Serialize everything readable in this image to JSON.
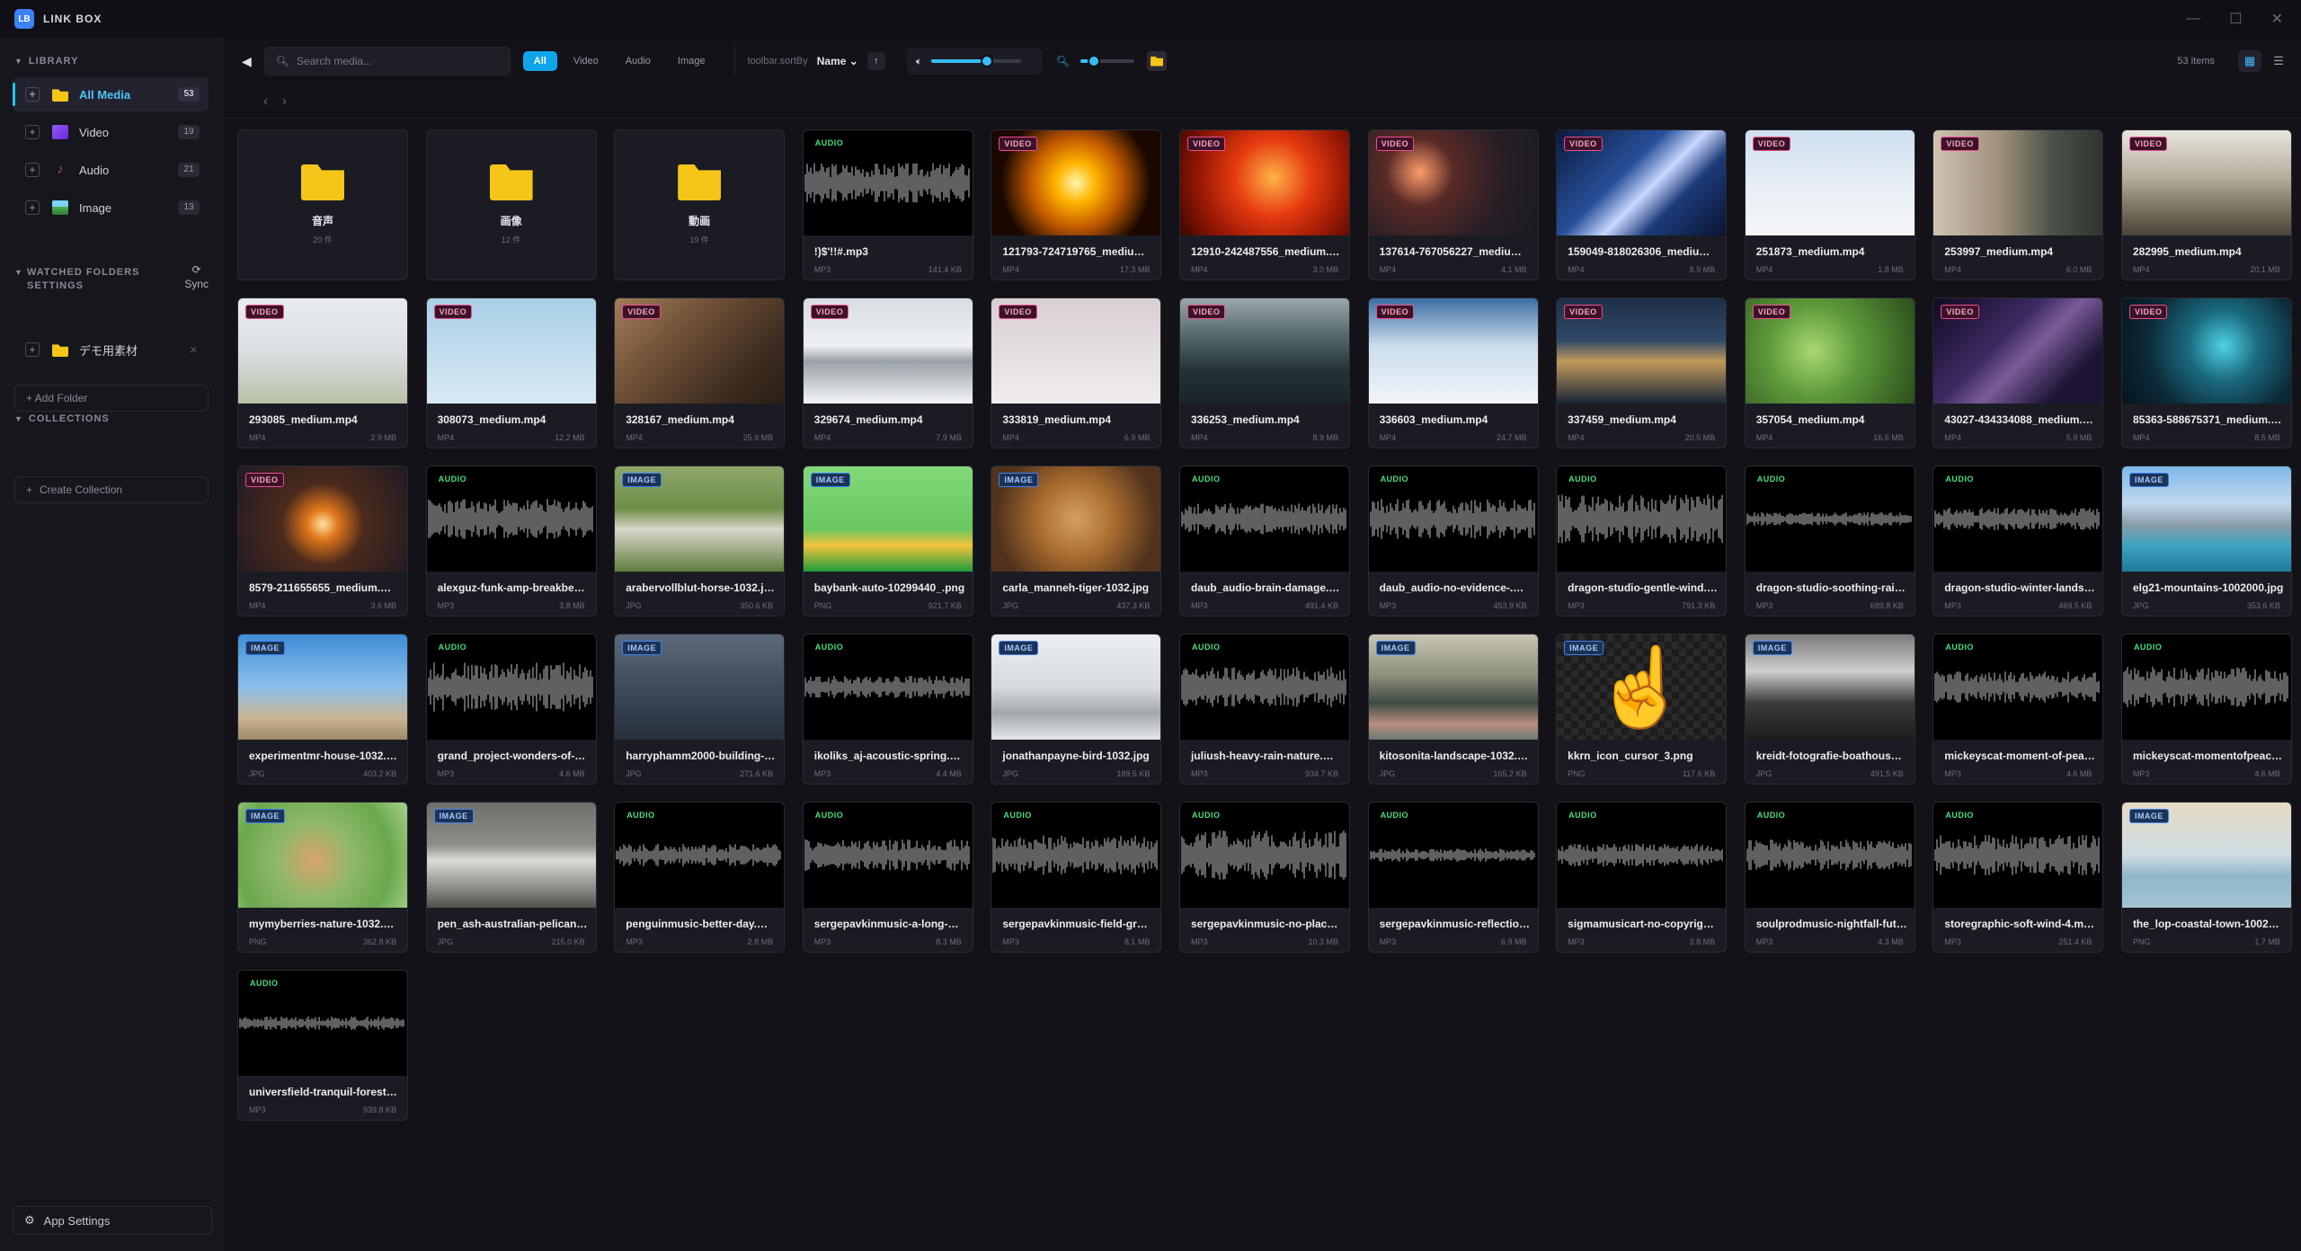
{
  "app": {
    "title": "LINK BOX",
    "logo_text": "LB"
  },
  "window_controls": [
    "—",
    "☐",
    "✕"
  ],
  "sidebar": {
    "library_heading": "LIBRARY",
    "items": [
      {
        "label": "All Media",
        "count": "53",
        "icon_color": "#f5c518",
        "active": true
      },
      {
        "label": "Video",
        "count": "19",
        "icon_color": "#8b5cf6",
        "active": false
      },
      {
        "label": "Audio",
        "count": "21",
        "icon_color": "#b9447a",
        "active": false
      },
      {
        "label": "Image",
        "count": "13",
        "icon_color": "#4caf50",
        "active": false
      }
    ],
    "watched_heading_1": "WATCHED FOLDERS",
    "watched_heading_2": "SETTINGS",
    "sync_label": "Sync",
    "watched_folder": "デモ用素材",
    "add_folder_label": "+ Add Folder",
    "collections_heading": "COLLECTIONS",
    "create_collection_label": "Create Collection",
    "app_settings_label": "App Settings"
  },
  "toolbar": {
    "search_placeholder": "Search media...",
    "filters": [
      "All",
      "Video",
      "Audio",
      "Image"
    ],
    "active_filter": "All",
    "sort_label": "toolbar.sortBy",
    "sort_value": "Name ⌄",
    "item_count": "53 items",
    "volume_level": 0.62,
    "zoom_level": 0.25
  },
  "colors": {
    "accent": "#0ea5e9",
    "video_badge": "#ee4d8f",
    "audio_badge": "#4ade80",
    "image_badge": "#3b82f6",
    "folder": "#f5c518"
  },
  "items": [
    {
      "kind": "folder",
      "name": "音声",
      "meta": "20 件"
    },
    {
      "kind": "folder",
      "name": "画像",
      "meta": "12 件"
    },
    {
      "kind": "folder",
      "name": "動画",
      "meta": "19 件"
    },
    {
      "kind": "audio",
      "badge": "AUDIO",
      "name": "!)$'!!#.mp3",
      "type": "MP3",
      "size": "141.4 KB"
    },
    {
      "kind": "video",
      "badge": "VIDEO",
      "name": "121793-724719765_medium.mp4",
      "type": "MP4",
      "size": "17.3 MB",
      "bg": "radial-gradient(circle at 50% 50%, #fff6b0 0%, #ffb400 20%, #c35a00 45%, #1a0800 75%)"
    },
    {
      "kind": "video",
      "badge": "VIDEO",
      "name": "12910-242487556_medium.mp4",
      "type": "MP4",
      "size": "3.0 MB",
      "bg": "radial-gradient(circle at 55% 45%, #ffb347 0%, #e63b10 35%, #9e1a05 65%, #3a0600 100%)"
    },
    {
      "kind": "video",
      "badge": "VIDEO",
      "name": "137614-767056227_medium.mp4",
      "type": "MP4",
      "size": "4.1 MB",
      "bg": "radial-gradient(circle at 30% 40%, #ff9c6b 0%, #5a2a26 25%, #2a1f26 60%, #1a1a22 100%)"
    },
    {
      "kind": "video",
      "badge": "VIDEO",
      "name": "159049-818026306_medium.mp4",
      "type": "MP4",
      "size": "8.9 MB",
      "bg": "linear-gradient(135deg, #0b1a3d 0%, #27509a 40%, #c9d7ff 55%, #1d3b7a 70%, #0a1430 100%)"
    },
    {
      "kind": "video",
      "badge": "VIDEO",
      "name": "251873_medium.mp4",
      "type": "MP4",
      "size": "1.8 MB",
      "bg": "linear-gradient(180deg, #cfe0f0 0%, #e8eef5 55%, #f5f7fa 100%)"
    },
    {
      "kind": "video",
      "badge": "VIDEO",
      "name": "253997_medium.mp4",
      "type": "MP4",
      "size": "6.0 MB",
      "bg": "linear-gradient(90deg, #cfc3b3 0%, #9e8f7b 40%, #4b5248 70%, #2d3530 100%)"
    },
    {
      "kind": "video",
      "badge": "VIDEO",
      "name": "282995_medium.mp4",
      "type": "MP4",
      "size": "20.1 MB",
      "bg": "linear-gradient(180deg, #e9e6df 0%, #b6ad9c 45%, #6f6657 80%, #4b4438 100%)"
    },
    {
      "kind": "video",
      "badge": "VIDEO",
      "name": "293085_medium.mp4",
      "type": "MP4",
      "size": "2.9 MB",
      "bg": "linear-gradient(180deg, #e9ecef 0%, #dadfe3 50%, #b7c1a8 100%)"
    },
    {
      "kind": "video",
      "badge": "VIDEO",
      "name": "308073_medium.mp4",
      "type": "MP4",
      "size": "12.2 MB",
      "bg": "linear-gradient(180deg, #a9cfe6 0%, #c6e0ef 60%, #d8eaf4 100%)"
    },
    {
      "kind": "video",
      "badge": "VIDEO",
      "name": "328167_medium.mp4",
      "type": "MP4",
      "size": "25.9 MB",
      "bg": "linear-gradient(135deg, #a27c5a 0%, #6b4d34 40%, #3d2c1f 75%, #2a1e15 100%)"
    },
    {
      "kind": "video",
      "badge": "VIDEO",
      "name": "329674_medium.mp4",
      "type": "MP4",
      "size": "7.9 MB",
      "bg": "linear-gradient(180deg, #d7dde3 0%, #eef1f4 45%, #9aa1a8 60%, #f4f6f8 100%)"
    },
    {
      "kind": "video",
      "badge": "VIDEO",
      "name": "333819_medium.mp4",
      "type": "MP4",
      "size": "6.9 MB",
      "bg": "linear-gradient(180deg, #d8cfd3 0%, #e6dfe2 55%, #f0ecee 100%)"
    },
    {
      "kind": "video",
      "badge": "VIDEO",
      "name": "336253_medium.mp4",
      "type": "MP4",
      "size": "8.9 MB",
      "bg": "linear-gradient(180deg, #9aa7ab 0%, #4d6066 40%, #233136 70%, #1a2428 100%)"
    },
    {
      "kind": "video",
      "badge": "VIDEO",
      "name": "336603_medium.mp4",
      "type": "MP4",
      "size": "24.7 MB",
      "bg": "linear-gradient(180deg, #3d6ea3 0%, #cbdcec 45%, #f2f6fa 100%)"
    },
    {
      "kind": "video",
      "badge": "VIDEO",
      "name": "337459_medium.mp4",
      "type": "MP4",
      "size": "20.5 MB",
      "bg": "linear-gradient(180deg, #1e2f48 0%, #2f4967 40%, #c19a5b 60%, #182536 100%)"
    },
    {
      "kind": "video",
      "badge": "VIDEO",
      "name": "357054_medium.mp4",
      "type": "MP4",
      "size": "16.6 MB",
      "bg": "radial-gradient(circle at 40% 50%, #a9d873 0%, #5d9a3a 40%, #2b4d1c 100%)"
    },
    {
      "kind": "video",
      "badge": "VIDEO",
      "name": "43027-434334088_medium.mp4",
      "type": "MP4",
      "size": "5.9 MB",
      "bg": "linear-gradient(135deg, #120a22 0%, #3d2a63 40%, #7a5b9a 55%, #1d1433 80%)"
    },
    {
      "kind": "video",
      "badge": "VIDEO",
      "name": "85363-588675371_medium.mp4",
      "type": "MP4",
      "size": "8.5 MB",
      "bg": "radial-gradient(circle at 60% 45%, #4fd2e6 0%, #1b6a7f 30%, #0c2a38 65%, #06141c 100%)"
    },
    {
      "kind": "video",
      "badge": "VIDEO",
      "name": "8579-211655655_medium.mp4",
      "type": "MP4",
      "size": "3.6 MB",
      "bg": "radial-gradient(circle at 50% 55%, #ffe2a0 0%, #e0761b 15%, #4b2a1c 40%, #1f1a24 100%)"
    },
    {
      "kind": "audio",
      "badge": "AUDIO",
      "name": "alexguz-funk-amp-breakbeat.mp3",
      "type": "MP3",
      "size": "3.8 MB"
    },
    {
      "kind": "image",
      "badge": "IMAGE",
      "name": "arabervollblut-horse-1032.jpg",
      "type": "JPG",
      "size": "350.6 KB",
      "bg": "linear-gradient(180deg, #8ea76b 0%, #6f8f48 40%, #d8d6cb 60%, #5e7e3b 100%)"
    },
    {
      "kind": "image",
      "badge": "IMAGE",
      "name": "baybank-auto-10299440_.png",
      "type": "PNG",
      "size": "921.7 KB",
      "bg": "linear-gradient(180deg, #82d97a 0%, #69c760 60%, #f3c23a 75%, #1b9e3c 100%)"
    },
    {
      "kind": "image",
      "badge": "IMAGE",
      "name": "carla_manneh-tiger-1032.jpg",
      "type": "JPG",
      "size": "437.3 KB",
      "bg": "radial-gradient(circle at 50% 50%, #d5a064 0%, #a66a2e 40%, #51331d 80%)"
    },
    {
      "kind": "audio",
      "badge": "AUDIO",
      "name": "daub_audio-brain-damage.mp3",
      "type": "MP3",
      "size": "491.4 KB"
    },
    {
      "kind": "audio",
      "badge": "AUDIO",
      "name": "daub_audio-no-evidence-.mp3",
      "type": "MP3",
      "size": "453.9 KB"
    },
    {
      "kind": "audio",
      "badge": "AUDIO",
      "name": "dragon-studio-gentle-wind.mp3",
      "type": "MP3",
      "size": "791.3 KB"
    },
    {
      "kind": "audio",
      "badge": "AUDIO",
      "name": "dragon-studio-soothing-rain.mp3",
      "type": "MP3",
      "size": "689.8 KB"
    },
    {
      "kind": "audio",
      "badge": "AUDIO",
      "name": "dragon-studio-winter-landscape.mp3",
      "type": "MP3",
      "size": "469.5 KB"
    },
    {
      "kind": "image",
      "badge": "IMAGE",
      "name": "elg21-mountains-1002000.jpg",
      "type": "JPG",
      "size": "353.6 KB",
      "bg": "linear-gradient(180deg, #7eb7e8 0%, #c0d9ee 35%, #8c9ea8 55%, #3fa3c0 75%, #1e7b99 100%)"
    },
    {
      "kind": "image",
      "badge": "IMAGE",
      "name": "experimentmr-house-1032.jpg",
      "type": "JPG",
      "size": "403.2 KB",
      "bg": "linear-gradient(180deg, #3f8cd6 0%, #8cc0eb 50%, #c9b48f 80%, #9d8a68 100%)"
    },
    {
      "kind": "audio",
      "badge": "AUDIO",
      "name": "grand_project-wonders-of-nature.mp3",
      "type": "MP3",
      "size": "4.6 MB"
    },
    {
      "kind": "image",
      "badge": "IMAGE",
      "name": "harryphamm2000-building-1032.jpg",
      "type": "JPG",
      "size": "271.6 KB",
      "bg": "linear-gradient(180deg, #5d6a7c 0%, #3e4b5c 50%, #27303c 100%)"
    },
    {
      "kind": "audio",
      "badge": "AUDIO",
      "name": "ikoliks_aj-acoustic-spring.mp3",
      "type": "MP3",
      "size": "4.4 MB"
    },
    {
      "kind": "image",
      "badge": "IMAGE",
      "name": "jonathanpayne-bird-1032.jpg",
      "type": "JPG",
      "size": "189.5 KB",
      "bg": "linear-gradient(180deg, #eceff1 0%, #d7dbde 50%, #a2a8ad 75%, #e4e7e9 100%)"
    },
    {
      "kind": "audio",
      "badge": "AUDIO",
      "name": "juliush-heavy-rain-nature.mp3",
      "type": "MP3",
      "size": "934.7 KB"
    },
    {
      "kind": "image",
      "badge": "IMAGE",
      "name": "kitosonita-landscape-1032.jpg",
      "type": "JPG",
      "size": "165.2 KB",
      "bg": "linear-gradient(180deg, #c9c5b6 0%, #8b8e7a 40%, #3d4a44 65%, #b98e7e 85%, #6b7a73 100%)"
    },
    {
      "kind": "image",
      "badge": "IMAGE",
      "name": "kkrn_icon_cursor_3.png",
      "type": "PNG",
      "size": "117.6 KB",
      "bg": "repeating-conic-gradient(#2a2a2a 0% 25%, #1c1c1c 0% 50%) 0 0 / 16px 16px"
    },
    {
      "kind": "image",
      "badge": "IMAGE",
      "name": "kreidt-fotografie-boathouse.jpg",
      "type": "JPG",
      "size": "491.5 KB",
      "bg": "linear-gradient(180deg, #7a7a7a 0%, #cfcfcf 35%, #3c3c3c 65%, #1c1c1c 100%)"
    },
    {
      "kind": "audio",
      "badge": "AUDIO",
      "name": "mickeyscat-moment-of-peace.mp3",
      "type": "MP3",
      "size": "4.6 MB"
    },
    {
      "kind": "audio",
      "badge": "AUDIO",
      "name": "mickeyscat-momentofpeace.mp3",
      "type": "MP3",
      "size": "4.6 MB"
    },
    {
      "kind": "image",
      "badge": "IMAGE",
      "name": "mymyberries-nature-1032.png",
      "type": "PNG",
      "size": "362.8 KB",
      "bg": "radial-gradient(circle at 45% 55%, #d9a36b 0%, #8fb86a 35%, #6aa84f 70%, #a8d28a 100%)"
    },
    {
      "kind": "image",
      "badge": "IMAGE",
      "name": "pen_ash-australian-pelican.jpg",
      "type": "JPG",
      "size": "215.0 KB",
      "bg": "linear-gradient(180deg, #6c6f6a 0%, #8d8e87 40%, #dcdcd6 55%, #4f524d 100%)"
    },
    {
      "kind": "audio",
      "badge": "AUDIO",
      "name": "penguinmusic-better-day.mp3",
      "type": "MP3",
      "size": "2.8 MB"
    },
    {
      "kind": "audio",
      "badge": "AUDIO",
      "name": "sergepavkinmusic-a-long-way.mp3",
      "type": "MP3",
      "size": "8.3 MB"
    },
    {
      "kind": "audio",
      "badge": "AUDIO",
      "name": "sergepavkinmusic-field-grass.mp3",
      "type": "MP3",
      "size": "8.1 MB"
    },
    {
      "kind": "audio",
      "badge": "AUDIO",
      "name": "sergepavkinmusic-no-place.mp3",
      "type": "MP3",
      "size": "10.3 MB"
    },
    {
      "kind": "audio",
      "badge": "AUDIO",
      "name": "sergepavkinmusic-reflection.mp3",
      "type": "MP3",
      "size": "6.9 MB"
    },
    {
      "kind": "audio",
      "badge": "AUDIO",
      "name": "sigmamusicart-no-copyright.mp3",
      "type": "MP3",
      "size": "3.8 MB"
    },
    {
      "kind": "audio",
      "badge": "AUDIO",
      "name": "soulprodmusic-nightfall-future.mp3",
      "type": "MP3",
      "size": "4.3 MB"
    },
    {
      "kind": "audio",
      "badge": "AUDIO",
      "name": "storegraphic-soft-wind-4.mp3",
      "type": "MP3",
      "size": "251.4 KB"
    },
    {
      "kind": "image",
      "badge": "IMAGE",
      "name": "the_lop-coastal-town-1002000.png",
      "type": "PNG",
      "size": "1.7 MB",
      "bg": "linear-gradient(180deg, #e6dac4 0%, #cfdde3 50%, #8fb6c9 70%, #a5c4d2 100%)"
    },
    {
      "kind": "audio",
      "badge": "AUDIO",
      "name": "universfield-tranquil-forest.mp3",
      "type": "MP3",
      "size": "939.8 KB"
    }
  ]
}
